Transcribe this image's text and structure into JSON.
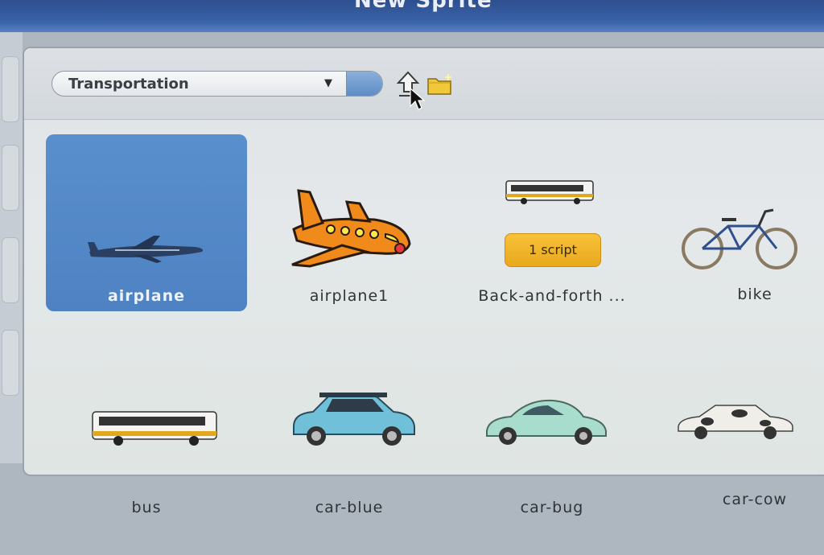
{
  "window": {
    "title": "New Sprite"
  },
  "toolbar": {
    "category": {
      "selected": "Transportation"
    },
    "up_icon": "up-arrow-icon",
    "new_folder_icon": "new-folder-icon"
  },
  "sprites": [
    {
      "label": "airplane",
      "selected": true
    },
    {
      "label": "airplane1",
      "selected": false
    },
    {
      "label": "Back-and-forth ...",
      "badge": "1 script",
      "selected": false
    },
    {
      "label": "bike",
      "selected": false
    },
    {
      "label": "bus",
      "selected": false
    },
    {
      "label": "car-blue",
      "selected": false
    },
    {
      "label": "car-bug",
      "selected": false
    },
    {
      "label": "car-cow",
      "selected": false
    }
  ],
  "colors": {
    "title_bar": "#3a64aa",
    "selection": "#5a8fcd",
    "script_badge": "#f2b52c"
  }
}
